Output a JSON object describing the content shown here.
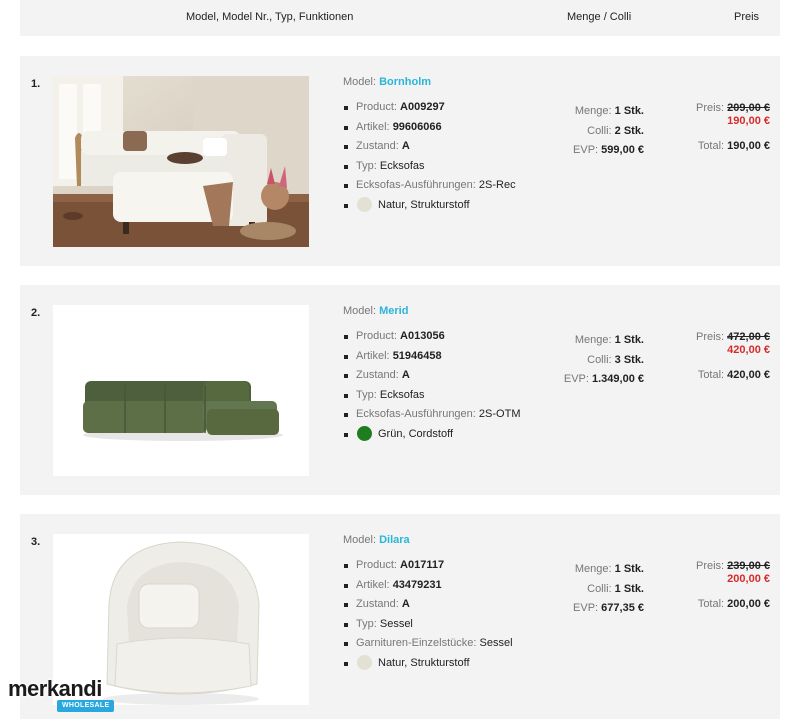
{
  "header": {
    "model_col": "Model, Model Nr., Typ, Funktionen",
    "qty_col": "Menge / Colli",
    "price_col": "Preis"
  },
  "items": [
    {
      "num": "1.",
      "model_label": "Model:",
      "model_name": "Bornholm",
      "product_label": "Product:",
      "product": "A009297",
      "artikel_label": "Artikel:",
      "artikel": "99606066",
      "zustand_label": "Zustand:",
      "zustand": "A",
      "typ_label": "Typ:",
      "typ": "Ecksofas",
      "extra_label": "Ecksofas-Ausführungen:",
      "extra_value": "2S-Rec",
      "color_name": "Natur, Strukturstoff",
      "color_hex": "#e3e1d3",
      "menge_label": "Menge:",
      "menge": "1 Stk.",
      "colli_label": "Colli:",
      "colli": "2 Stk.",
      "evp_label": "EVP:",
      "evp": "599,00 €",
      "preis_label": "Preis:",
      "preis_old": "209,00 €",
      "preis_new": "190,00 €",
      "total_label": "Total:",
      "total": "190,00 €",
      "image_icon": "corner-sofa-photo"
    },
    {
      "num": "2.",
      "model_label": "Model:",
      "model_name": "Merid",
      "product_label": "Product:",
      "product": "A013056",
      "artikel_label": "Artikel:",
      "artikel": "51946458",
      "zustand_label": "Zustand:",
      "zustand": "A",
      "typ_label": "Typ:",
      "typ": "Ecksofas",
      "extra_label": "Ecksofas-Ausführungen:",
      "extra_value": "2S-OTM",
      "color_name": "Grün, Cordstoff",
      "color_hex": "#1f7d1f",
      "menge_label": "Menge:",
      "menge": "1 Stk.",
      "colli_label": "Colli:",
      "colli": "3 Stk.",
      "evp_label": "EVP:",
      "evp": "1.349,00 €",
      "preis_label": "Preis:",
      "preis_old": "472,00 €",
      "preis_new": "420,00 €",
      "total_label": "Total:",
      "total": "420,00 €",
      "image_icon": "green-sofa-photo"
    },
    {
      "num": "3.",
      "model_label": "Model:",
      "model_name": "Dilara",
      "product_label": "Product:",
      "product": "A017117",
      "artikel_label": "Artikel:",
      "artikel": "43479231",
      "zustand_label": "Zustand:",
      "zustand": "A",
      "typ_label": "Typ:",
      "typ": "Sessel",
      "extra_label": "Garnituren-Einzelstücke:",
      "extra_value": "Sessel",
      "color_name": "Natur, Strukturstoff",
      "color_hex": "#e3e1d3",
      "menge_label": "Menge:",
      "menge": "1 Stk.",
      "colli_label": "Colli:",
      "colli": "1 Stk.",
      "evp_label": "EVP:",
      "evp": "677,35 €",
      "preis_label": "Preis:",
      "preis_old": "239,00 €",
      "preis_new": "200,00 €",
      "total_label": "Total:",
      "total": "200,00 €",
      "image_icon": "armchair-photo"
    }
  ],
  "logo": {
    "name": "merkandi",
    "badge": "WHOLESALE"
  }
}
